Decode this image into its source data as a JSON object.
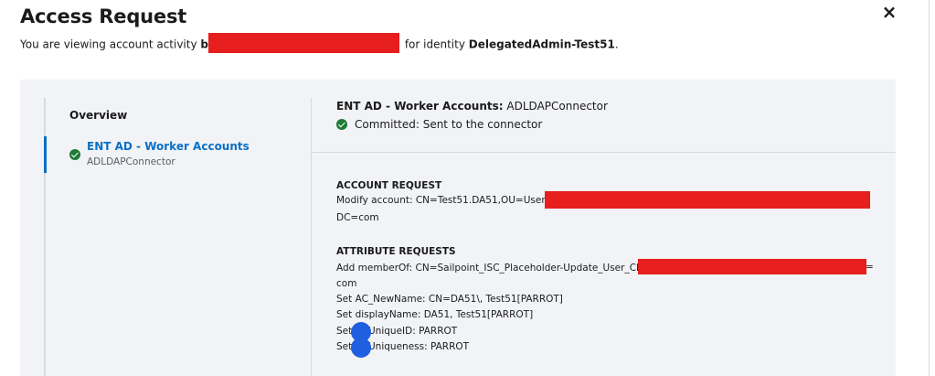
{
  "dialog": {
    "title": "Access Request",
    "subtitle_prefix": "You are viewing account activity",
    "subtitle_partial": "b",
    "subtitle_mid": "for identity",
    "identity": "DelegatedAdmin-Test51",
    "subtitle_suffix": ".",
    "close_icon": "×"
  },
  "sidebar": {
    "overview_label": "Overview",
    "items": [
      {
        "name": "ENT AD - Worker Accounts",
        "sub": "ADLDAPConnector",
        "status_icon": "check-circle-icon"
      }
    ]
  },
  "detail": {
    "heading_label": "ENT AD - Worker Accounts:",
    "heading_connector": "ADLDAPConnector",
    "status_text": "Committed: Sent to the connector",
    "account_request_label": "ACCOUNT REQUEST",
    "account_request_line1": "Modify account: CN=Test51.DA51,OU=Users,OU",
    "account_request_line2": "DC=com",
    "attribute_requests_label": "ATTRIBUTE REQUESTS",
    "attr_line1": "Add memberOf: CN=Sailpoint_ISC_Placeholder-Update_User_CN,OU",
    "attr_line1_tail": "=",
    "attr_line2": "com",
    "attr_line3": "Set AC_NewName: CN=DA51\\, Test51[PARROT]",
    "attr_line4": "Set displayName: DA51, Test51[PARROT]",
    "attr_line5_prefix": "Set",
    "attr_line5_suffix": "UniqueID: PARROT",
    "attr_line6_prefix": "Set",
    "attr_line6_suffix": "Uniqueness: PARROT"
  },
  "colors": {
    "accent": "#0b6fc4",
    "success": "#1e7a34",
    "redaction": "#e61e1e",
    "panel_bg": "#f1f3f6"
  }
}
